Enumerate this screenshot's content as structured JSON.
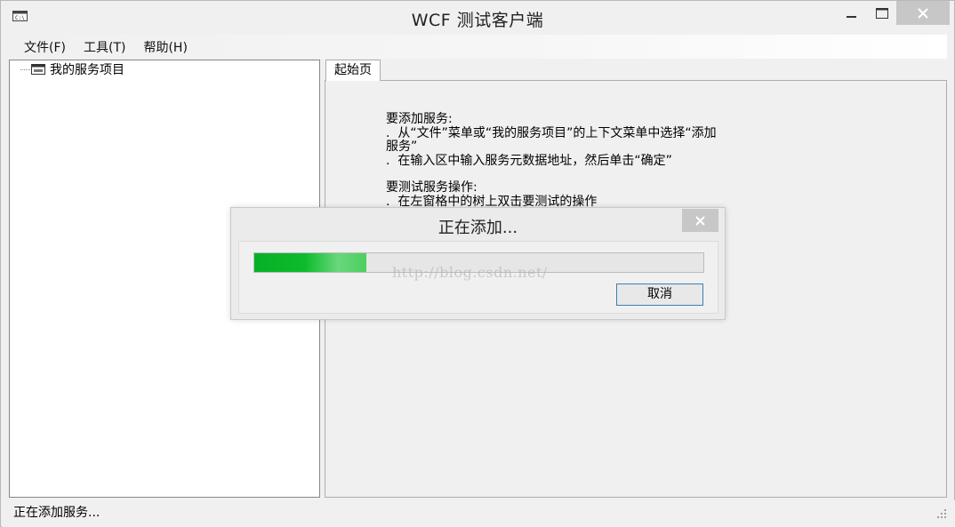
{
  "window": {
    "title": "WCF 测试客户端"
  },
  "menubar": {
    "items": [
      {
        "label": "文件(F)"
      },
      {
        "label": "工具(T)"
      },
      {
        "label": "帮助(H)"
      }
    ]
  },
  "tree": {
    "root_label": "我的服务项目",
    "root_icon": "service-folder-icon"
  },
  "tabs": [
    {
      "label": "起始页"
    }
  ],
  "start_page": {
    "lines": [
      "要添加服务:",
      ".  从“文件”菜单或“我的服务项目”的上下文菜单中选择“添加",
      "服务”",
      ".  在输入区中输入服务元数据地址，然后单击“确定”",
      "",
      "要测试服务操作:",
      ".  在左窗格中的树上双击要测试的操作"
    ]
  },
  "statusbar": {
    "text": "正在添加服务..."
  },
  "dialog": {
    "title": "正在添加...",
    "progress_fraction": 0.25,
    "cancel_label": "取消"
  },
  "watermark": {
    "text": "http://blog.csdn.net/"
  },
  "colors": {
    "progress_green": "#06b025",
    "close_button_bg": "#c7c7c7",
    "button_border": "#3c7fb1"
  }
}
